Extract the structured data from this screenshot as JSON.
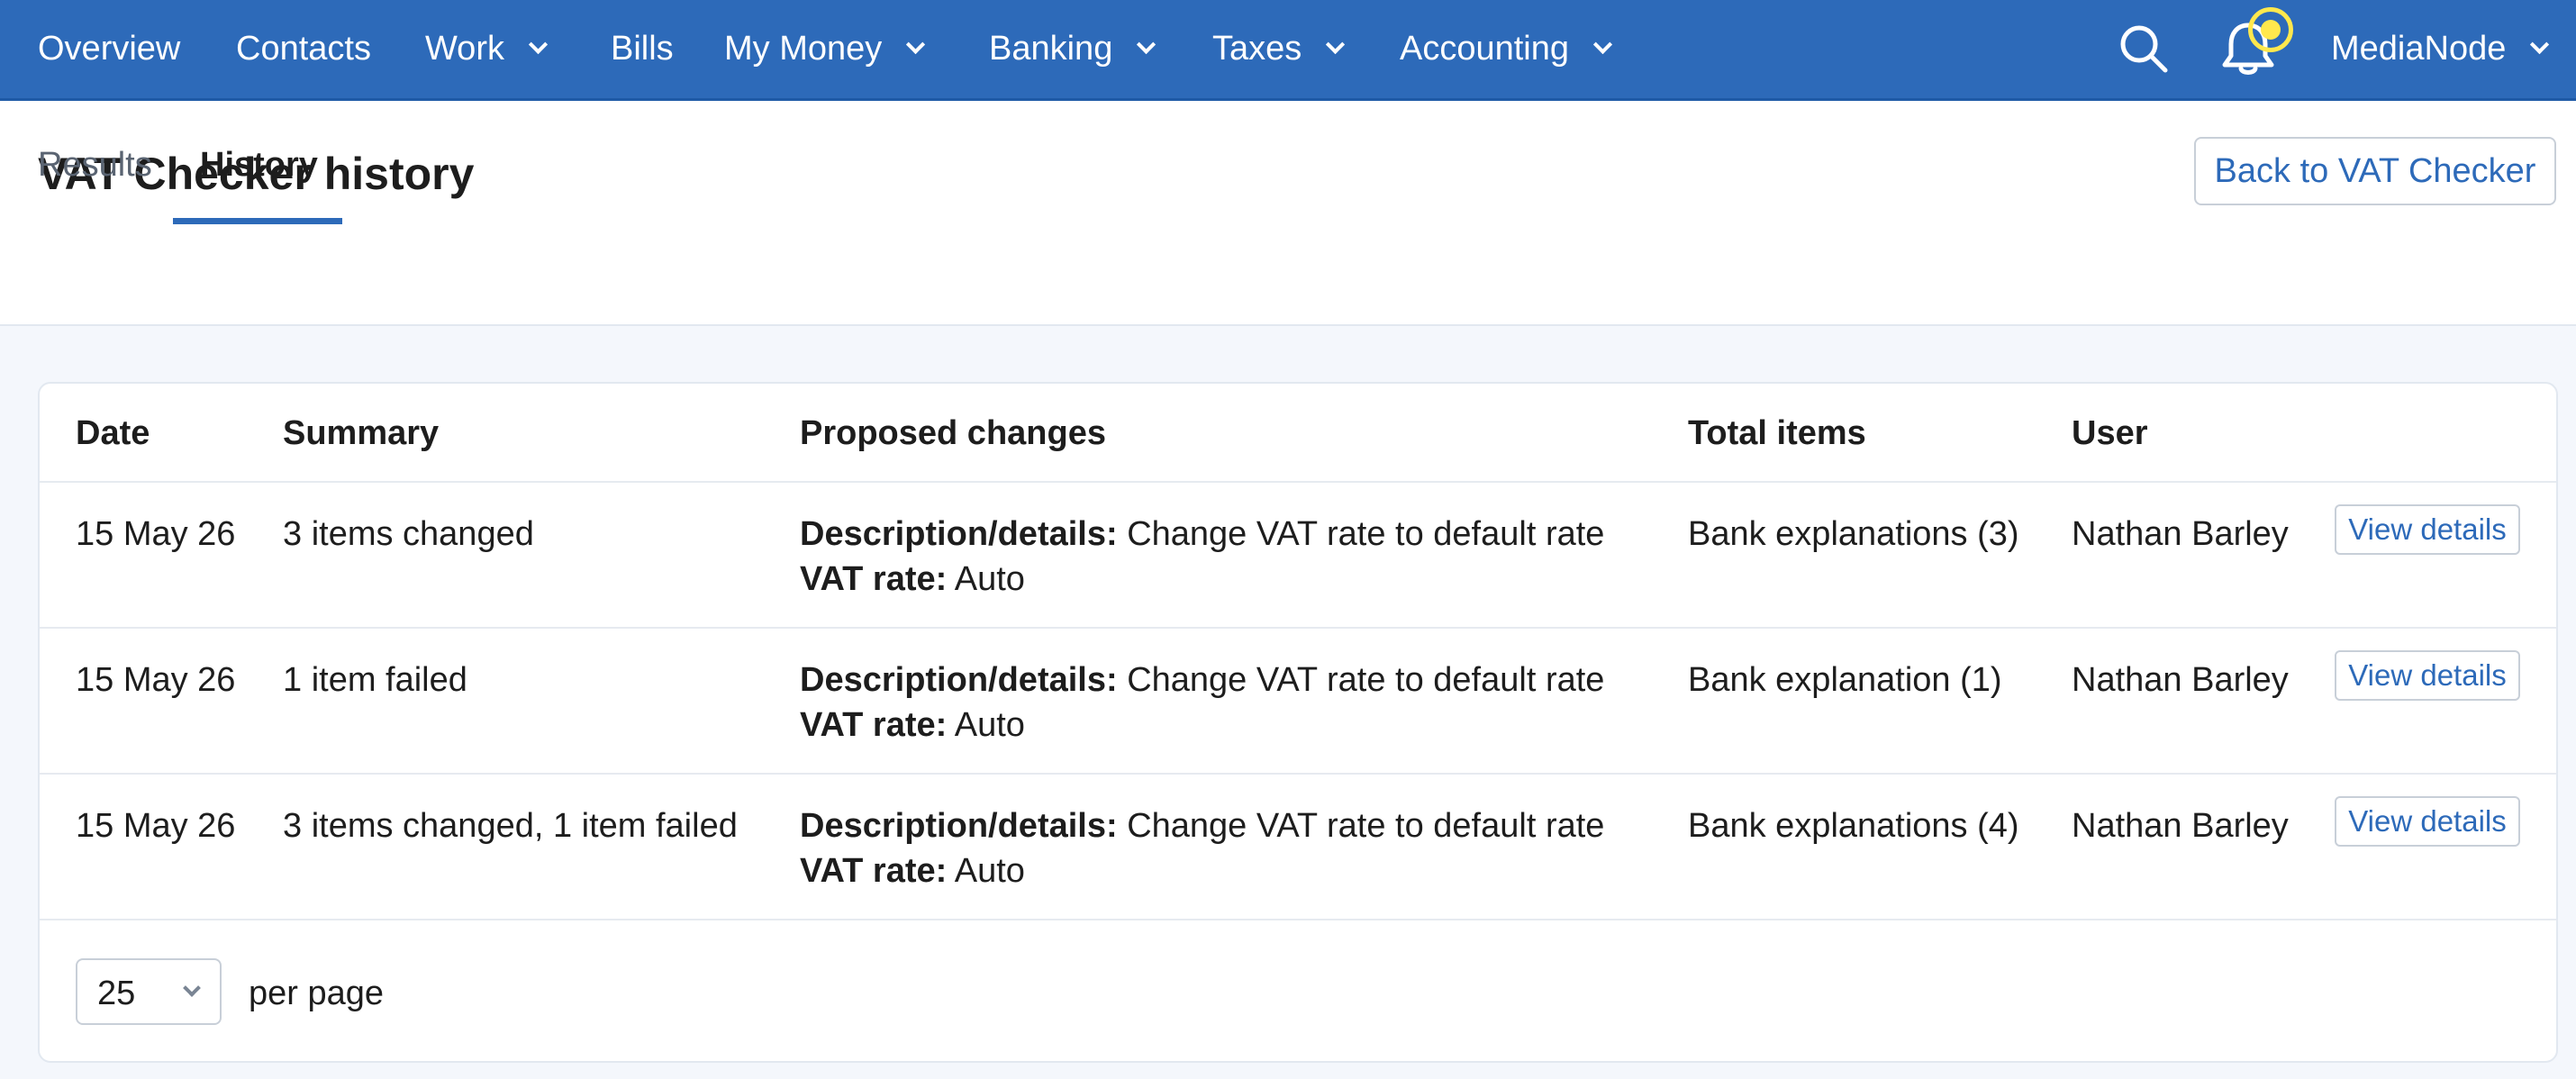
{
  "nav": {
    "items": [
      {
        "label": "Overview",
        "dropdown": false
      },
      {
        "label": "Contacts",
        "dropdown": false
      },
      {
        "label": "Work",
        "dropdown": true
      },
      {
        "label": "Bills",
        "dropdown": false
      },
      {
        "label": "My Money",
        "dropdown": true
      },
      {
        "label": "Banking",
        "dropdown": true
      },
      {
        "label": "Taxes",
        "dropdown": true
      },
      {
        "label": "Accounting",
        "dropdown": true
      }
    ],
    "account_label": "MediaNode",
    "icons": {
      "search": "search-icon",
      "notifications": "bell-icon",
      "notification_indicator": "notification-dot-icon"
    },
    "colors": {
      "nav_bg": "#2d6ab9",
      "accent": "#2d6ab9",
      "notification": "#ffe84d"
    }
  },
  "header": {
    "title": "VAT Checker history",
    "back_button": "Back to VAT Checker",
    "tabs": [
      {
        "label": "Results",
        "active": false
      },
      {
        "label": "History",
        "active": true
      }
    ]
  },
  "table": {
    "columns": [
      "Date",
      "Summary",
      "Proposed changes",
      "Total items",
      "User"
    ],
    "rows": [
      {
        "date": "15 May 26",
        "summary": "3 items changed",
        "change1_key": "Description/details:",
        "change1_value": "Change VAT rate to default rate",
        "change2_key": "VAT rate:",
        "change2_value": "Auto",
        "total_items": "Bank explanations (3)",
        "user": "Nathan Barley",
        "action": "View details"
      },
      {
        "date": "15 May 26",
        "summary": "1 item failed",
        "change1_key": "Description/details:",
        "change1_value": "Change VAT rate to default rate",
        "change2_key": "VAT rate:",
        "change2_value": "Auto",
        "total_items": "Bank explanation (1)",
        "user": "Nathan Barley",
        "action": "View details"
      },
      {
        "date": "15 May 26",
        "summary": "3 items changed, 1 item failed",
        "change1_key": "Description/details:",
        "change1_value": "Change VAT rate to default rate",
        "change2_key": "VAT rate:",
        "change2_value": "Auto",
        "total_items": "Bank explanations (4)",
        "user": "Nathan Barley",
        "action": "View details"
      }
    ]
  },
  "pagination": {
    "per_page_value": "25",
    "per_page_label": "per page"
  }
}
